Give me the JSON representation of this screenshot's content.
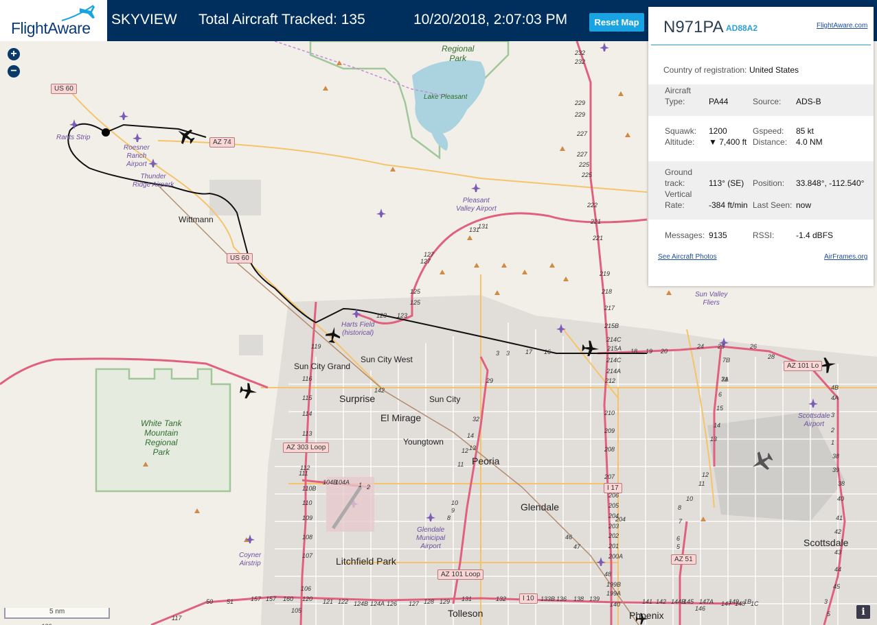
{
  "header": {
    "brand": "FlightAware",
    "app_name": "SKYVIEW",
    "total_tracked": "Total Aircraft Tracked: 135",
    "datetime": "10/20/2018, 2:07:03 PM",
    "reset_label": "Reset Map"
  },
  "map": {
    "zoom_in": "+",
    "zoom_out": "−",
    "scale": "5 nm",
    "info": "i",
    "places": [
      {
        "text": "Wittmann",
        "name": "place-wittmann"
      },
      {
        "text": "Sun City Grand",
        "name": "place-sun-city-grand"
      },
      {
        "text": "Sun City West",
        "name": "place-sun-city-west"
      },
      {
        "text": "Sun City",
        "name": "place-sun-city"
      },
      {
        "text": "Youngtown",
        "name": "place-youngtown"
      }
    ],
    "cities": [
      {
        "text": "Surprise",
        "name": "city-surprise"
      },
      {
        "text": "El Mirage",
        "name": "city-el-mirage"
      },
      {
        "text": "Peoria",
        "name": "city-peoria"
      },
      {
        "text": "Glendale",
        "name": "city-glendale"
      },
      {
        "text": "Litchfield Park",
        "name": "city-litchfield-park"
      },
      {
        "text": "Tolleson",
        "name": "city-tolleson"
      },
      {
        "text": "Scottsdale",
        "name": "city-scottsdale"
      },
      {
        "text": "Phoenix",
        "name": "city-phoenix"
      }
    ],
    "airports": [
      {
        "lines": [
          "Rants Strip"
        ],
        "name": "airport-rants-strip"
      },
      {
        "lines": [
          "Roesner",
          "Ranch",
          "Airport"
        ],
        "name": "airport-roesner-ranch"
      },
      {
        "lines": [
          "Thunder",
          "Ridge Airpark"
        ],
        "name": "airport-thunder-ridge"
      },
      {
        "lines": [
          "Pleasant",
          "Valley Airport"
        ],
        "name": "airport-pleasant-valley"
      },
      {
        "lines": [
          "Harts Field",
          "(historical)"
        ],
        "name": "airport-harts-field"
      },
      {
        "lines": [
          "Sun Valley",
          "Fliers"
        ],
        "name": "airport-sun-valley-fliers"
      },
      {
        "lines": [
          "Scottsdale",
          "Airport"
        ],
        "name": "airport-scottsdale"
      },
      {
        "lines": [
          "Glendale",
          "Municipal",
          "Airport"
        ],
        "name": "airport-glendale-municipal"
      },
      {
        "lines": [
          "Coyner",
          "Airstrip"
        ],
        "name": "airport-coyner-airstrip"
      }
    ],
    "parks": [
      {
        "lines": [
          "Regional",
          "Park"
        ],
        "name": "park-lake-pleasant-regional"
      },
      {
        "lines": [
          "Lake Pleasant"
        ],
        "name": "lake-pleasant"
      },
      {
        "lines": [
          "White Tank",
          "Mountain",
          "Regional",
          "Park"
        ],
        "name": "park-white-tank-mountain"
      }
    ],
    "shields": [
      {
        "text": "US 60",
        "name": "shield-us-60-north"
      },
      {
        "text": "AZ 74",
        "name": "shield-az-74"
      },
      {
        "text": "US 60",
        "name": "shield-us-60-south"
      },
      {
        "text": "AZ 303 Loop",
        "name": "shield-az-303-loop"
      },
      {
        "text": "AZ 101 Loop",
        "name": "shield-az-101-loop-west"
      },
      {
        "text": "AZ 101 Lo",
        "name": "shield-az-101-loop-east"
      },
      {
        "text": "I 17",
        "name": "shield-i-17"
      },
      {
        "text": "I 10",
        "name": "shield-i-10"
      },
      {
        "text": "AZ 51",
        "name": "shield-az-51"
      }
    ],
    "route_numbers": [
      "232",
      "232",
      "229",
      "229",
      "227",
      "227",
      "225",
      "225",
      "222",
      "221",
      "221",
      "219",
      "218",
      "217",
      "215B",
      "214C",
      "215A",
      "214C",
      "214A",
      "212",
      "210",
      "209",
      "208",
      "207",
      "206",
      "205",
      "204",
      "204",
      "203",
      "202",
      "201",
      "200A",
      "199B",
      "199A",
      "131",
      "131",
      "127",
      "127",
      "125",
      "125",
      "123",
      "123",
      "119",
      "116",
      "115",
      "114",
      "113",
      "112",
      "111",
      "110B",
      "110",
      "109",
      "108",
      "107",
      "106",
      "105",
      "104B",
      "104A",
      "1",
      "2",
      "3",
      "3",
      "17",
      "16",
      "18",
      "19",
      "20",
      "24",
      "25",
      "26",
      "28",
      "29",
      "31",
      "32",
      "14",
      "13",
      "12",
      "11",
      "10",
      "9",
      "8",
      "7B",
      "7A",
      "6",
      "15",
      "14",
      "13",
      "12",
      "11",
      "10",
      "8",
      "7",
      "6",
      "5",
      "4B",
      "4A",
      "3",
      "2",
      "1",
      "38",
      "39",
      "38",
      "40",
      "41",
      "42",
      "43",
      "44",
      "45",
      "46",
      "47",
      "48",
      "50",
      "51",
      "157",
      "157",
      "160",
      "120",
      "121",
      "122",
      "124B",
      "124A",
      "126",
      "127",
      "128",
      "129",
      "131",
      "132",
      "133B",
      "136",
      "138",
      "139",
      "140",
      "141",
      "142",
      "144B",
      "145",
      "146",
      "147A",
      "147",
      "148",
      "149",
      "1B",
      "1C",
      "3",
      "5",
      "117",
      "100",
      "142"
    ],
    "aircraft": [
      "aircraft-selected-n971pa",
      "aircraft-harts",
      "aircraft-west",
      "aircraft-arrowhead",
      "aircraft-101-east",
      "aircraft-scottsdale",
      "aircraft-phoenix"
    ]
  },
  "panel": {
    "registration": "N971PA",
    "hex": "AD88A2",
    "fa_link": "FlightAware.com",
    "country_label": "Country of registration:",
    "country_value": "United States",
    "aircraft_type_label_1": "Aircraft",
    "aircraft_type_label_2": "Type:",
    "aircraft_type_value": "PA44",
    "source_label": "Source:",
    "source_value": "ADS-B",
    "squawk_label": "Squawk:",
    "squawk_value": "1200",
    "gspeed_label": "Gspeed:",
    "gspeed_value": "85 kt",
    "altitude_label": "Altitude:",
    "altitude_value": "▼ 7,400 ft",
    "distance_label": "Distance:",
    "distance_value": "4.0 NM",
    "ground_track_label_1": "Ground",
    "ground_track_label_2": "track:",
    "ground_track_value": "113° (SE)",
    "position_label": "Position:",
    "position_value": "33.848°, -112.540°",
    "vertical_rate_label_1": "Vertical",
    "vertical_rate_label_2": "Rate:",
    "vertical_rate_value": "-384 ft/min",
    "last_seen_label": "Last Seen:",
    "last_seen_value": "now",
    "messages_label": "Messages:",
    "messages_value": "9135",
    "rssi_label": "RSSI:",
    "rssi_value": "-1.4 dBFS",
    "photos_link": "See Aircraft Photos",
    "airframes_link": "AirFrames.org"
  },
  "colors": {
    "header_bg": "#002f5d",
    "reset_button": "#19a3e3",
    "panel_accent": "#2a9fd6",
    "route_primary": "#e0607e",
    "route_secondary": "#f5c46a",
    "park_border": "#9fc79a",
    "water": "#aad3df"
  }
}
